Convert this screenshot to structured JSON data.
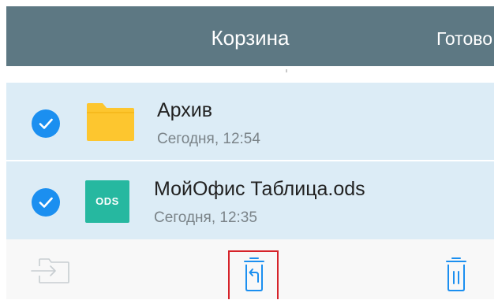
{
  "navbar": {
    "title": "Корзина",
    "done_label": "Готово"
  },
  "files": [
    {
      "name": "Архив",
      "date": "Сегодня, 12:54",
      "type_icon": "folder-icon",
      "selected": true
    },
    {
      "name": "МойОфис Таблица.ods",
      "date": "Сегодня, 12:35",
      "type_icon": "ods-file-icon",
      "icon_text": "ODS",
      "selected": true
    }
  ],
  "toolbar": {
    "move_icon": "move-to-folder-icon",
    "move_enabled": false,
    "restore_icon": "restore-icon",
    "restore_highlighted": true,
    "delete_icon": "delete-permanently-icon"
  },
  "colors": {
    "navbar": "#5d7883",
    "selection": "#dcecf6",
    "checkbox": "#1b8ff0",
    "folder": "#fdc62f",
    "ods": "#26b8a0",
    "accent": "#1b8ff0",
    "highlight_border": "#d6232a"
  }
}
